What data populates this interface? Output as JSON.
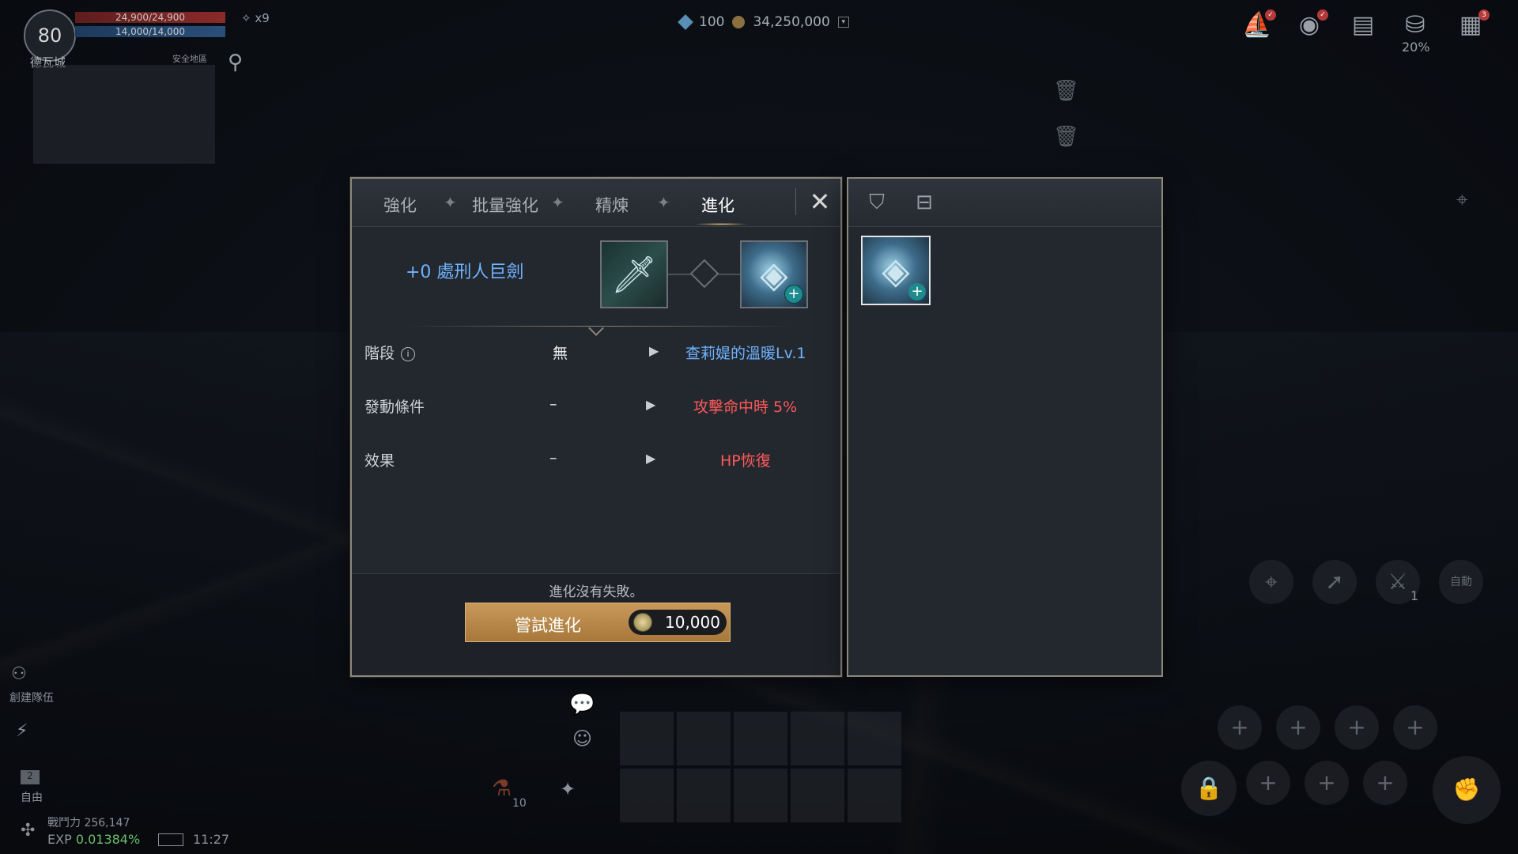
{
  "hud": {
    "level": "80",
    "hp": "24,900/24,900",
    "mp": "14,000/14,000",
    "buff_count": "x9",
    "zone": "德瓦城",
    "safe_zone": "安全地區",
    "diamonds": "100",
    "gold": "34,250,000",
    "weight_pct": "20%",
    "mail_badge": "3",
    "create_team": "創建隊伍",
    "free_label": "自由",
    "free_count": "2",
    "combat_label": "戰鬥力",
    "combat_power": "256,147",
    "exp_label": "EXP",
    "exp_value": "0.01384%",
    "time": "11:27",
    "potion_count": "10",
    "skill_count": "1",
    "auto_label": "自動"
  },
  "panel": {
    "tabs": [
      "強化",
      "批量強化",
      "精煉",
      "進化"
    ],
    "active_tab": "進化",
    "item_name": "+0 處刑人巨劍",
    "rows": [
      {
        "label": "階段",
        "current": "無",
        "next": "查莉媞的溫暖Lv.1",
        "next_color": "blue"
      },
      {
        "label": "發動條件",
        "current": "–",
        "next": "攻擊命中時 5%",
        "next_color": "red"
      },
      {
        "label": "效果",
        "current": "–",
        "next": "HP恢復",
        "next_color": "red"
      }
    ],
    "note": "進化沒有失敗。",
    "button_label": "嘗試進化",
    "cost": "10,000"
  },
  "colors": {
    "accent_blue": "#6fb4ff",
    "accent_red": "#ff5a5a",
    "button": "#b88648",
    "panel_border": "#8c877b"
  }
}
